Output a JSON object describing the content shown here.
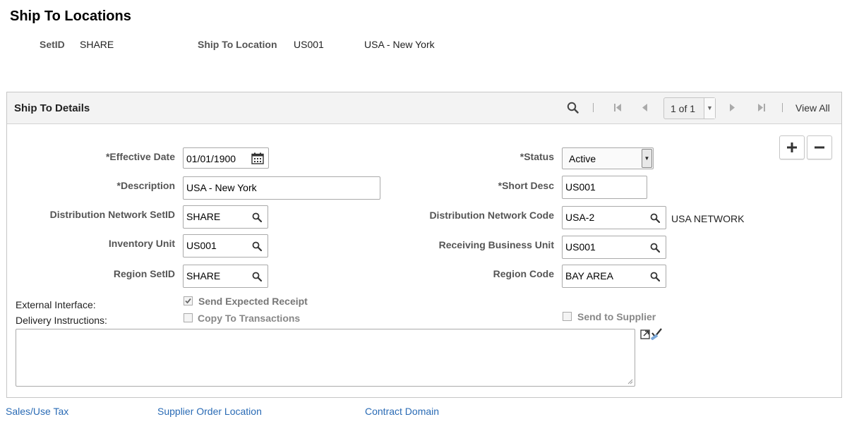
{
  "page_title": "Ship To Locations",
  "header": {
    "setid_label": "SetID",
    "setid_value": "SHARE",
    "location_label": "Ship To Location",
    "location_value": "US001",
    "location_desc": "USA - New York"
  },
  "panel": {
    "title": "Ship To Details",
    "pager_text": "1 of 1",
    "view_all": "View All"
  },
  "fields": {
    "effective_date": {
      "label": "*Effective Date",
      "value": "01/01/1900"
    },
    "status": {
      "label": "*Status",
      "value": "Active"
    },
    "description": {
      "label": "*Description",
      "value": "USA - New York"
    },
    "short_desc": {
      "label": "*Short Desc",
      "value": "US001"
    },
    "dist_net_setid": {
      "label": "Distribution Network SetID",
      "value": "SHARE"
    },
    "dist_net_code": {
      "label": "Distribution Network Code",
      "value": "USA-2",
      "desc": "USA NETWORK"
    },
    "inventory_unit": {
      "label": "Inventory Unit",
      "value": "US001"
    },
    "receiving_bu": {
      "label": "Receiving Business Unit",
      "value": "US001"
    },
    "region_setid": {
      "label": "Region SetID",
      "value": "SHARE"
    },
    "region_code": {
      "label": "Region Code",
      "value": "BAY AREA"
    }
  },
  "external_interface_label": "External Interface:",
  "delivery_instructions_label": "Delivery Instructions:",
  "checkboxes": {
    "send_expected_receipt": {
      "label": "Send Expected Receipt",
      "checked": true
    },
    "copy_to_transactions": {
      "label": "Copy To Transactions",
      "checked": false
    },
    "send_to_supplier": {
      "label": "Send to Supplier",
      "checked": false
    }
  },
  "links": {
    "sales_use_tax": "Sales/Use Tax",
    "supplier_order_location": "Supplier Order Location",
    "contract_domain": "Contract Domain"
  },
  "colors": {
    "link": "#2a6bb5",
    "header_bg": "#f3f3f3"
  }
}
